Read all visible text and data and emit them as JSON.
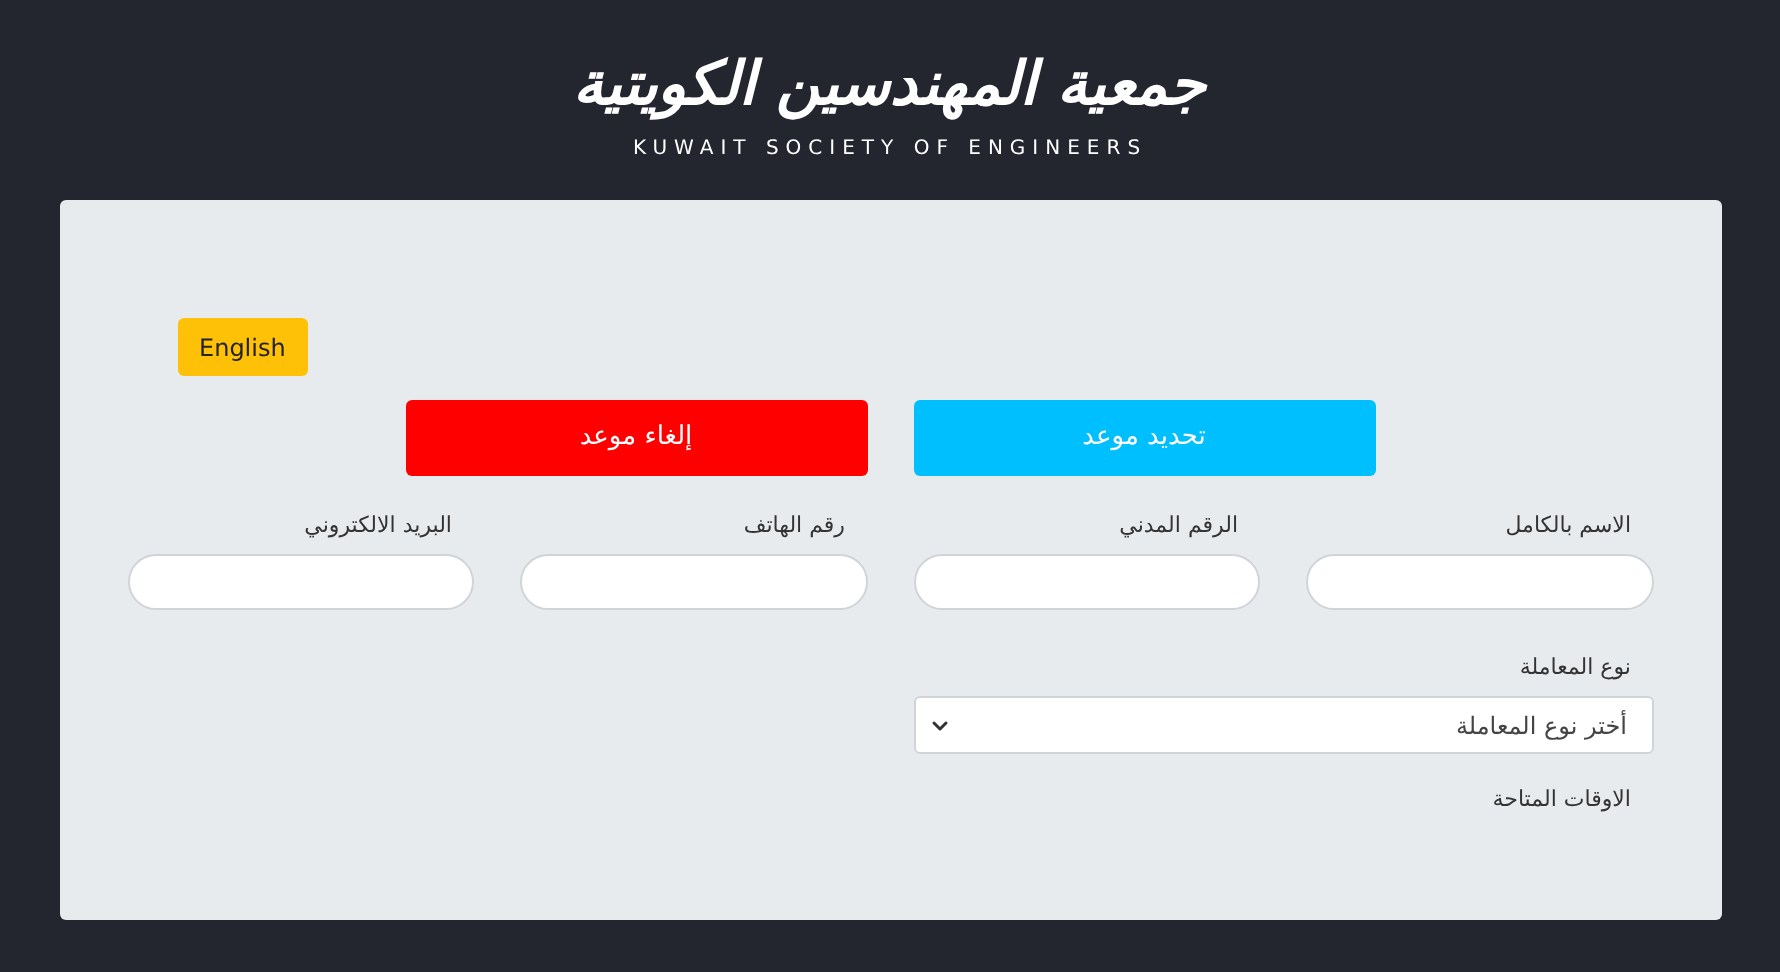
{
  "logo": {
    "arabic": "جمعية المهندسين الكويتية",
    "english": "KUWAIT SOCIETY OF ENGINEERS"
  },
  "language_button": "English",
  "actions": [
    {
      "label": "تحديد موعد",
      "kind": "book"
    },
    {
      "label": "إلغاء موعد",
      "kind": "cancel"
    }
  ],
  "fields": [
    {
      "label": "الاسم بالكامل"
    },
    {
      "label": "الرقم المدني"
    },
    {
      "label": "رقم الهاتف"
    },
    {
      "label": "البريد الالكتروني"
    }
  ],
  "transaction_type": {
    "label": "نوع المعاملة",
    "placeholder": "أختر نوع المعاملة"
  },
  "available_times": {
    "label": "الاوقات المتاحة"
  }
}
